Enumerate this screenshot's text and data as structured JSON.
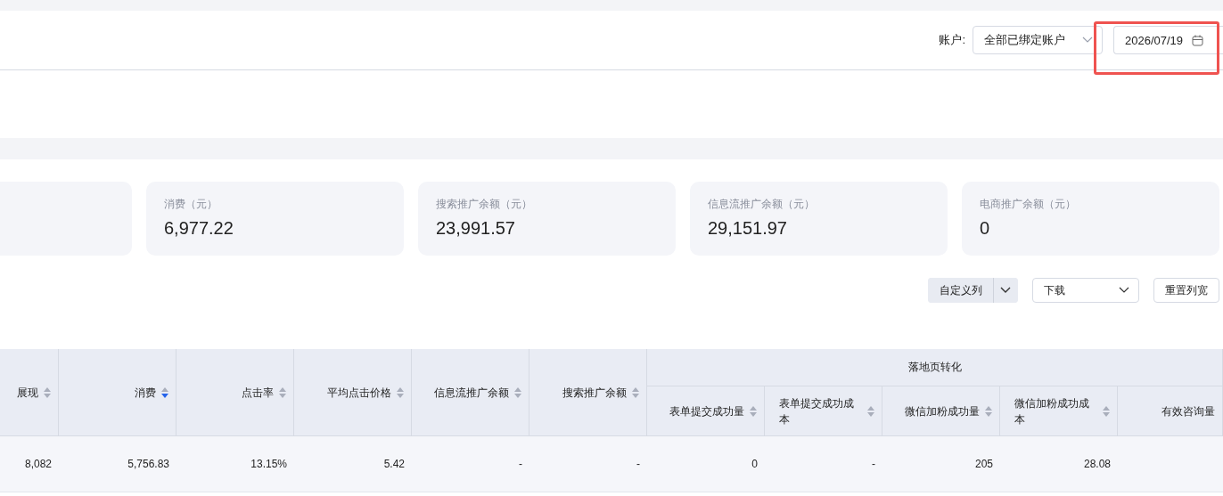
{
  "account_filter": {
    "label": "账户:",
    "value": "全部已绑定账户"
  },
  "date_picker": {
    "value": "2026/07/19"
  },
  "cards": [
    {
      "label": "消费（元）",
      "value": "6,977.22"
    },
    {
      "label": "搜索推广余额（元）",
      "value": "23,991.57"
    },
    {
      "label": "信息流推广余额（元）",
      "value": "29,151.97"
    },
    {
      "label": "电商推广余额（元）",
      "value": "0"
    }
  ],
  "toolbar": {
    "custom_columns": "自定义列",
    "download": "下载",
    "reset_widths": "重置列宽"
  },
  "table": {
    "columns": [
      {
        "label": "展现",
        "sorted_desc": false
      },
      {
        "label": "消费",
        "sorted_desc": true
      },
      {
        "label": "点击率",
        "sorted_desc": false
      },
      {
        "label": "平均点击价格",
        "sorted_desc": false
      },
      {
        "label": "信息流推广余额",
        "sorted_desc": false
      },
      {
        "label": "搜索推广余额",
        "sorted_desc": false
      }
    ],
    "column_group": {
      "label": "落地页转化",
      "children": [
        {
          "label": "表单提交成功量",
          "sorted_desc": false
        },
        {
          "label": "表单提交成功成本",
          "sorted_desc": false
        },
        {
          "label": "微信加粉成功量",
          "sorted_desc": false
        },
        {
          "label": "微信加粉成功成本",
          "sorted_desc": false
        },
        {
          "label": "有效咨询量"
        }
      ]
    },
    "rows": [
      {
        "cells": [
          "8,082",
          "5,756.83",
          "13.15%",
          "5.42",
          "-",
          "-",
          "0",
          "-",
          "205",
          "28.08"
        ]
      }
    ]
  }
}
